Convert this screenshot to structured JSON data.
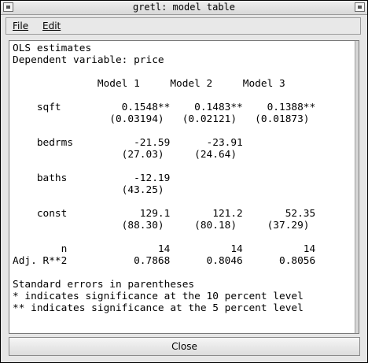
{
  "window": {
    "title": "gretl: model table"
  },
  "menu": {
    "file_label": "File",
    "edit_label": "Edit"
  },
  "model_table": {
    "heading": "OLS estimates",
    "dependent_variable_line": "Dependent variable: price",
    "columns": [
      "Model 1",
      "Model 2",
      "Model 3"
    ],
    "rows": [
      {
        "variable": "sqft",
        "coefficients": [
          "0.1548**",
          "0.1483**",
          "0.1388**"
        ],
        "std_errors": [
          "(0.03194)",
          "(0.02121)",
          "(0.01873)"
        ]
      },
      {
        "variable": "bedrms",
        "coefficients": [
          "-21.59",
          "-23.91",
          ""
        ],
        "std_errors": [
          "(27.03)",
          "(24.64)",
          ""
        ]
      },
      {
        "variable": "baths",
        "coefficients": [
          "-12.19",
          "",
          ""
        ],
        "std_errors": [
          "(43.25)",
          "",
          ""
        ]
      },
      {
        "variable": "const",
        "coefficients": [
          "129.1",
          "121.2",
          "52.35"
        ],
        "std_errors": [
          "(88.30)",
          "(80.18)",
          "(37.29)"
        ]
      }
    ],
    "stats": [
      {
        "label": "n",
        "values": [
          "14",
          "14",
          "14"
        ]
      },
      {
        "label": "Adj. R**2",
        "values": [
          "0.7868",
          "0.8046",
          "0.8056"
        ]
      }
    ],
    "notes": [
      "Standard errors in parentheses",
      "* indicates significance at the 10 percent level",
      "** indicates significance at the 5 percent level"
    ]
  },
  "buttons": {
    "close_label": "Close"
  }
}
